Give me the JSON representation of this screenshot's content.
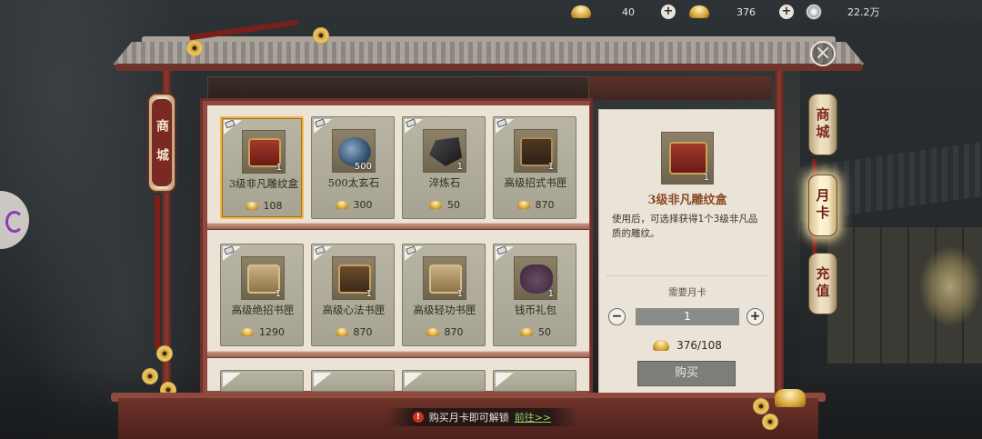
{
  "currencies": [
    {
      "icon": "gold-ingot-icon",
      "value": "40"
    },
    {
      "icon": "silver-ingot-icon",
      "value": "376"
    },
    {
      "icon": "copper-coin-icon",
      "value": "22.2万"
    }
  ],
  "left_tag": {
    "label": "商城"
  },
  "tabs": [
    {
      "label": "商城",
      "active": false
    },
    {
      "label": "月卡",
      "active": true
    },
    {
      "label": "充值",
      "active": false
    }
  ],
  "items": [
    {
      "name": "3级非凡雕纹盒",
      "count": "1",
      "price": "108",
      "art": "box-red",
      "selected": true
    },
    {
      "name": "500太玄石",
      "count": "500",
      "price": "300",
      "art": "stone",
      "selected": false
    },
    {
      "name": "淬炼石",
      "count": "1",
      "price": "50",
      "art": "ore",
      "selected": false
    },
    {
      "name": "高级招式书匣",
      "count": "1",
      "price": "870",
      "art": "chest-open",
      "selected": false
    },
    {
      "name": "高级绝招书匣",
      "count": "1",
      "price": "1290",
      "art": "chest-light",
      "selected": false
    },
    {
      "name": "高级心法书匣",
      "count": "1",
      "price": "870",
      "art": "chest-brown",
      "selected": false
    },
    {
      "name": "高级轻功书匣",
      "count": "1",
      "price": "870",
      "art": "chest-light",
      "selected": false
    },
    {
      "name": "钱币礼包",
      "count": "1",
      "price": "50",
      "art": "pouch",
      "selected": false
    }
  ],
  "detail": {
    "count": "1",
    "title": "3级非凡雕纹盒",
    "description": "使用后，可选择获得1个3级非凡品质的雕纹。",
    "requirement": "需要月卡",
    "quantity": "1",
    "cost": "376/108",
    "buy_label": "购买",
    "minus": "−",
    "plus": "+"
  },
  "unlock_bar": {
    "warn": "!",
    "text": "购买月卡即可解锁",
    "link": "前往>>"
  },
  "close_label": "×",
  "plus_label": "+"
}
